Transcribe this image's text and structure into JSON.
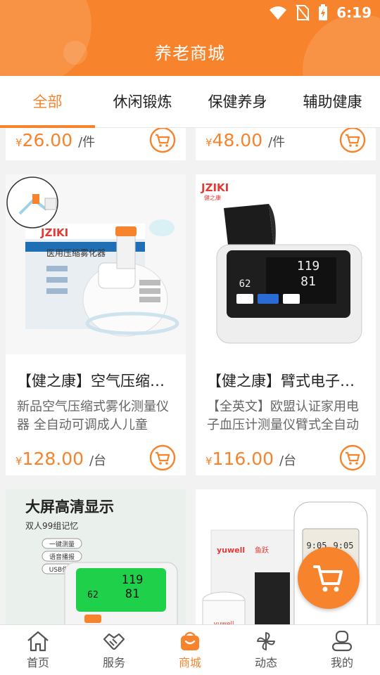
{
  "status": {
    "time": "6:19"
  },
  "header": {
    "title": "养老商城"
  },
  "tabs": [
    {
      "label": "全部",
      "active": true
    },
    {
      "label": "休闲锻炼",
      "active": false
    },
    {
      "label": "保健养身",
      "active": false
    },
    {
      "label": "辅助健康",
      "active": false
    }
  ],
  "top_cards": [
    {
      "currency": "¥",
      "price": "26.00",
      "unit": "/件"
    },
    {
      "currency": "¥",
      "price": "48.00",
      "unit": "/件"
    }
  ],
  "products": [
    {
      "name": "【健之康】空气压缩式雾化器",
      "desc": "新品空气压缩式雾化测量仪器 全自动可调成人儿童",
      "currency": "¥",
      "price": "128.00",
      "unit": "/台",
      "image_text": {
        "brand": "JZIKI",
        "product": "医用压缩雾化器"
      }
    },
    {
      "name": "【健之康】臂式电子血压计",
      "desc": "【全英文】欧盟认证家用电子血压计测量仪臂式全自动",
      "currency": "¥",
      "price": "116.00",
      "unit": "/台",
      "image_text": {
        "brand": "JZIKI",
        "brand_sub": "健之康",
        "readings": [
          "119",
          "81",
          "62"
        ]
      }
    },
    {
      "image_text": {
        "headline": "大屏高清显示",
        "subline": "双人99组记忆",
        "features": [
          "一键测量",
          "语音播报",
          "USB供电"
        ],
        "readings": [
          "119",
          "81",
          "62"
        ]
      }
    },
    {
      "image_text": {
        "brand": "yuwell",
        "brand_cn": "鱼跃",
        "readings": [
          "9:05",
          "9:05"
        ]
      }
    }
  ],
  "bottom_nav": [
    {
      "label": "首页",
      "icon": "home-icon",
      "active": false
    },
    {
      "label": "服务",
      "icon": "handshake-icon",
      "active": false
    },
    {
      "label": "商城",
      "icon": "shopping-bag-icon",
      "active": true
    },
    {
      "label": "动态",
      "icon": "pinwheel-icon",
      "active": false
    },
    {
      "label": "我的",
      "icon": "user-icon",
      "active": false
    }
  ],
  "colors": {
    "accent": "#f7842c",
    "text": "#222222",
    "muted": "#666666"
  }
}
